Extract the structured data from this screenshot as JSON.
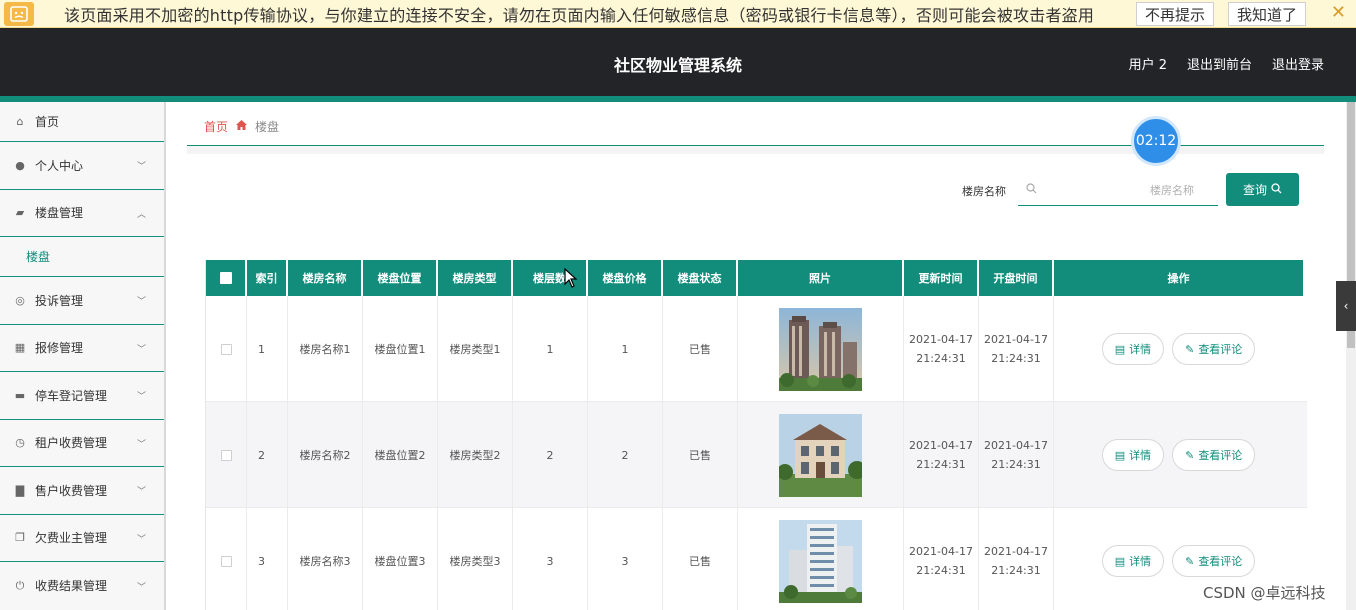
{
  "browser_warning": {
    "message": "该页面采用不加密的http传输协议，与你建立的连接不安全，请勿在页面内输入任何敏感信息（密码或银行卡信息等），否则可能会被攻击者盗用",
    "dont_remind_label": "不再提示",
    "got_it_label": "我知道了",
    "close_glyph": "✕"
  },
  "header": {
    "title": "社区物业管理系统",
    "user": "用户 2",
    "back_front": "退出到前台",
    "logout": "退出登录"
  },
  "sidebar": {
    "items": [
      {
        "label": "首页",
        "icon": "home-icon",
        "glyph": "⌂",
        "expandable": false
      },
      {
        "label": "个人中心",
        "icon": "user-icon",
        "glyph": "●",
        "expandable": true
      },
      {
        "label": "楼盘管理",
        "icon": "building-icon",
        "glyph": "▰",
        "expandable": true,
        "expanded": true
      },
      {
        "label": "投诉管理",
        "icon": "complaint-icon",
        "glyph": "◎",
        "expandable": true
      },
      {
        "label": "报修管理",
        "icon": "grid-icon",
        "glyph": "▦",
        "expandable": true
      },
      {
        "label": "停车登记管理",
        "icon": "ticket-icon",
        "glyph": "▬",
        "expandable": true
      },
      {
        "label": "租户收费管理",
        "icon": "clock-icon",
        "glyph": "◷",
        "expandable": true
      },
      {
        "label": "售户收费管理",
        "icon": "printer-icon",
        "glyph": "▇",
        "expandable": true
      },
      {
        "label": "欠费业主管理",
        "icon": "copy-icon",
        "glyph": "❐",
        "expandable": true
      },
      {
        "label": "收费结果管理",
        "icon": "power-icon",
        "glyph": "⏻",
        "expandable": true
      }
    ],
    "sub_item": "楼盘"
  },
  "breadcrumb": {
    "home": "首页",
    "current": "楼盘"
  },
  "search": {
    "label": "楼房名称",
    "placeholder": "楼房名称",
    "value": "",
    "button": "查询"
  },
  "timer": "02:12",
  "table": {
    "columns": [
      "索引",
      "楼房名称",
      "楼盘位置",
      "楼房类型",
      "楼层数",
      "楼盘价格",
      "楼盘状态",
      "照片",
      "更新时间",
      "开盘时间",
      "操作"
    ],
    "rows": [
      {
        "index": "1",
        "name": "楼房名称1",
        "location": "楼盘位置1",
        "type": "楼房类型1",
        "floors": "1",
        "price": "1",
        "status": "已售",
        "photo": "tower-photo",
        "updated": "2021-04-17 21:24:31",
        "opened": "2021-04-17 21:24:31"
      },
      {
        "index": "2",
        "name": "楼房名称2",
        "location": "楼盘位置2",
        "type": "楼房类型2",
        "floors": "2",
        "price": "2",
        "status": "已售",
        "photo": "villa-photo",
        "updated": "2021-04-17 21:24:31",
        "opened": "2021-04-17 21:24:31"
      },
      {
        "index": "3",
        "name": "楼房名称3",
        "location": "楼盘位置3",
        "type": "楼房类型3",
        "floors": "3",
        "price": "3",
        "status": "已售",
        "photo": "apartment-photo",
        "updated": "2021-04-17 21:24:31",
        "opened": "2021-04-17 21:24:31"
      }
    ],
    "actions": {
      "detail": "详情",
      "comments": "查看评论"
    }
  },
  "watermark": "CSDN @卓远科技",
  "colors": {
    "accent": "#128d7c",
    "header_bg": "#232427",
    "breadcrumb_home": "#e0544f"
  }
}
